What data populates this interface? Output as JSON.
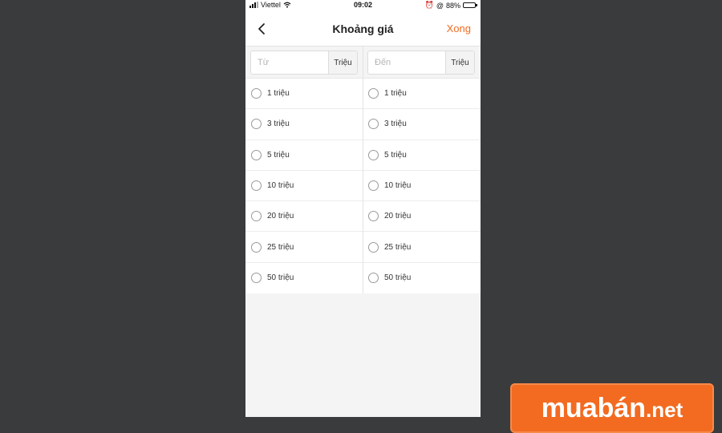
{
  "status_bar": {
    "carrier": "Viettel",
    "time": "09:02",
    "battery_percent": "88%",
    "battery_level": 0.88
  },
  "nav": {
    "title": "Khoảng giá",
    "done_label": "Xong"
  },
  "inputs": {
    "from_placeholder": "Từ",
    "from_value": "",
    "from_unit": "Triệu",
    "to_placeholder": "Đến",
    "to_value": "",
    "to_unit": "Triệu"
  },
  "options": {
    "from": [
      "1 triệu",
      "3 triệu",
      "5 triệu",
      "10 triệu",
      "20 triệu",
      "25 triệu",
      "50 triệu"
    ],
    "to": [
      "1 triệu",
      "3 triệu",
      "5 triệu",
      "10 triệu",
      "20 triệu",
      "25 triệu",
      "50 triệu"
    ]
  },
  "brand": {
    "name": "muabán",
    "suffix": ".net"
  },
  "colors": {
    "accent": "#f26b21",
    "background": "#3a3b3d"
  }
}
